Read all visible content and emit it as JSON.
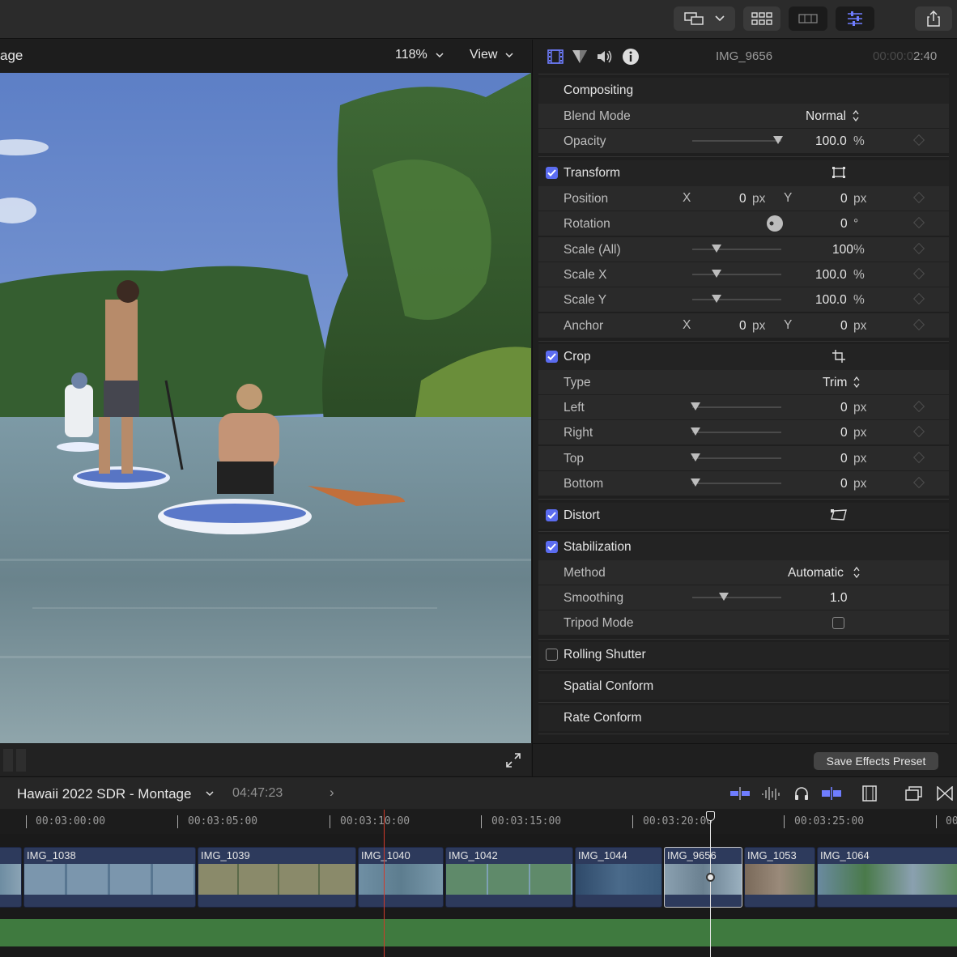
{
  "viewer": {
    "title": "age",
    "zoom": "118%",
    "view_menu": "View",
    "zoom_chevron": "⌄",
    "view_chevron": "⌄"
  },
  "inspector": {
    "clip_name": "IMG_9656",
    "clip_time_dim": "00:00:0",
    "clip_time": "2:40",
    "compositing": {
      "title": "Compositing",
      "blend_mode_label": "Blend Mode",
      "blend_mode_value": "Normal",
      "opacity_label": "Opacity",
      "opacity_value": "100.0",
      "opacity_unit": "%"
    },
    "transform": {
      "title": "Transform",
      "enabled": true,
      "position_label": "Position",
      "position_x": "0",
      "position_y": "0",
      "rotation_label": "Rotation",
      "rotation_value": "0",
      "rotation_unit": "°",
      "scale_all_label": "Scale (All)",
      "scale_all_value": "100",
      "scale_x_label": "Scale X",
      "scale_x_value": "100.0",
      "scale_y_label": "Scale Y",
      "scale_y_value": "100.0",
      "anchor_label": "Anchor",
      "anchor_x": "0",
      "anchor_y": "0",
      "px": "px",
      "pct": "%",
      "x": "X",
      "y": "Y"
    },
    "crop": {
      "title": "Crop",
      "enabled": true,
      "type_label": "Type",
      "type_value": "Trim",
      "left_label": "Left",
      "left_value": "0",
      "right_label": "Right",
      "right_value": "0",
      "top_label": "Top",
      "top_value": "0",
      "bottom_label": "Bottom",
      "bottom_value": "0",
      "px": "px"
    },
    "distort": {
      "title": "Distort",
      "enabled": true
    },
    "stabilization": {
      "title": "Stabilization",
      "enabled": true,
      "method_label": "Method",
      "method_value": "Automatic",
      "smoothing_label": "Smoothing",
      "smoothing_value": "1.0",
      "tripod_label": "Tripod Mode",
      "tripod_enabled": false
    },
    "rolling_shutter": {
      "title": "Rolling Shutter",
      "enabled": false
    },
    "spatial_conform": {
      "title": "Spatial Conform"
    },
    "rate_conform": {
      "title": "Rate Conform"
    },
    "save_preset": "Save Effects Preset"
  },
  "timeline": {
    "project_name": "Hawaii 2022 SDR - Montage",
    "project_chevron": "⌄",
    "duration": "04:47:23",
    "next": "›",
    "ruler": [
      "00:03:00:00",
      "00:03:05:00",
      "00:03:10:00",
      "00:03:15:00",
      "00:03:20:00",
      "00:03:25:00",
      "00"
    ],
    "clips": [
      "IMG_1038",
      "IMG_1039",
      "IMG_1040",
      "IMG_1042",
      "IMG_1044",
      "IMG_9656",
      "IMG_1053",
      "IMG_1064"
    ]
  },
  "icons": {
    "toolbar": [
      "layout-icon",
      "chevron-down-icon",
      "grid-icon",
      "filmstrip-icon",
      "inspector-icon",
      "share-icon"
    ],
    "inspector_tabs": [
      "video-tab-icon",
      "color-tab-icon",
      "audio-tab-icon",
      "info-tab-icon"
    ]
  },
  "colors": {
    "accent": "#5b6cf0",
    "clip_blue": "#2d3a5c",
    "audio_green": "#3f7a3f",
    "playhead_red": "#d03a2a"
  }
}
